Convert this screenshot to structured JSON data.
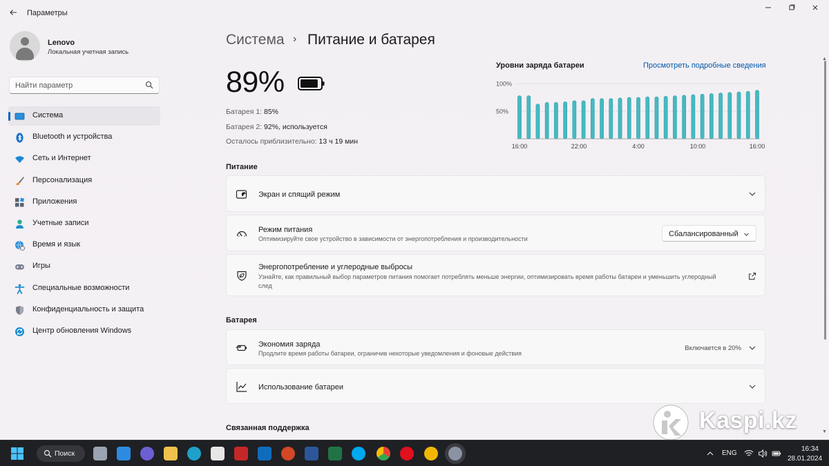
{
  "window": {
    "title": "Параметры",
    "back_icon": "arrow-left-icon",
    "controls": [
      "minimize-icon",
      "maximize-icon",
      "close-icon"
    ]
  },
  "profile": {
    "name": "Lenovo",
    "account_type": "Локальная учетная запись"
  },
  "search": {
    "placeholder": "Найти параметр"
  },
  "sidebar": {
    "items": [
      {
        "label": "Система",
        "icon": "display-icon",
        "active": true
      },
      {
        "label": "Bluetooth и устройства",
        "icon": "bluetooth-icon"
      },
      {
        "label": "Сеть и Интернет",
        "icon": "wifi-icon"
      },
      {
        "label": "Персонализация",
        "icon": "brush-icon"
      },
      {
        "label": "Приложения",
        "icon": "apps-icon"
      },
      {
        "label": "Учетные записи",
        "icon": "person-icon"
      },
      {
        "label": "Время и язык",
        "icon": "globe-clock-icon"
      },
      {
        "label": "Игры",
        "icon": "gamepad-icon"
      },
      {
        "label": "Специальные возможности",
        "icon": "accessibility-icon"
      },
      {
        "label": "Конфиденциальность и защита",
        "icon": "shield-icon"
      },
      {
        "label": "Центр обновления Windows",
        "icon": "update-icon"
      }
    ]
  },
  "header": {
    "parent": "Система",
    "separator": "›",
    "title": "Питание и батарея"
  },
  "battery": {
    "percent": "89%",
    "level": 0.89,
    "stats": [
      {
        "label": "Батарея 1:",
        "value": "85%"
      },
      {
        "label": "Батарея 2:",
        "value": "92%, используется"
      },
      {
        "label": "Осталось приблизительно:",
        "value": "13 ч 19 мин"
      }
    ]
  },
  "chart_data": {
    "type": "bar",
    "title": "Уровни заряда батареи",
    "link": "Просмотреть подробные сведения",
    "y_ticks": [
      "100%",
      "50%"
    ],
    "x_ticks": [
      "16:00",
      "22:00",
      "4:00",
      "10:00",
      "16:00"
    ],
    "ylim": [
      0,
      100
    ],
    "values": [
      78,
      78,
      63,
      66,
      66,
      67,
      69,
      69,
      73,
      73,
      73,
      74,
      75,
      75,
      76,
      76,
      77,
      78,
      79,
      80,
      81,
      82,
      83,
      84,
      85,
      86,
      88
    ],
    "color": "#46b9c1"
  },
  "power": {
    "section_title": "Питание",
    "items": [
      {
        "title": "Экран и спящий режим",
        "icon": "screen-sleep-icon"
      },
      {
        "title": "Режим питания",
        "desc": "Оптимизируйте свое устройство в зависимости от энергопотребления и производительности",
        "icon": "speedometer-icon",
        "dropdown": "Сбалансированный"
      },
      {
        "title": "Энергопотребление и углеродные выбросы",
        "desc": "Узнайте, как правильный выбор параметров питания помогает потреблять меньше энергии, оптимизировать время работы батареи и уменьшить углеродный след",
        "icon": "leaf-shield-icon"
      }
    ]
  },
  "battery_section": {
    "section_title": "Батарея",
    "items": [
      {
        "title": "Экономия заряда",
        "desc": "Продлите время работы батареи, ограничив некоторые уведомления и фоновые действия",
        "icon": "battery-saver-icon",
        "note": "Включается в 20%"
      },
      {
        "title": "Использование батареи",
        "icon": "line-chart-icon"
      }
    ]
  },
  "related": {
    "section_title": "Связанная поддержка"
  },
  "watermark": {
    "text": "Kaspi.kz"
  },
  "taskbar": {
    "search_label": "Поиск",
    "language": "ENG",
    "time": "16:34",
    "date": "28.01.2024"
  }
}
